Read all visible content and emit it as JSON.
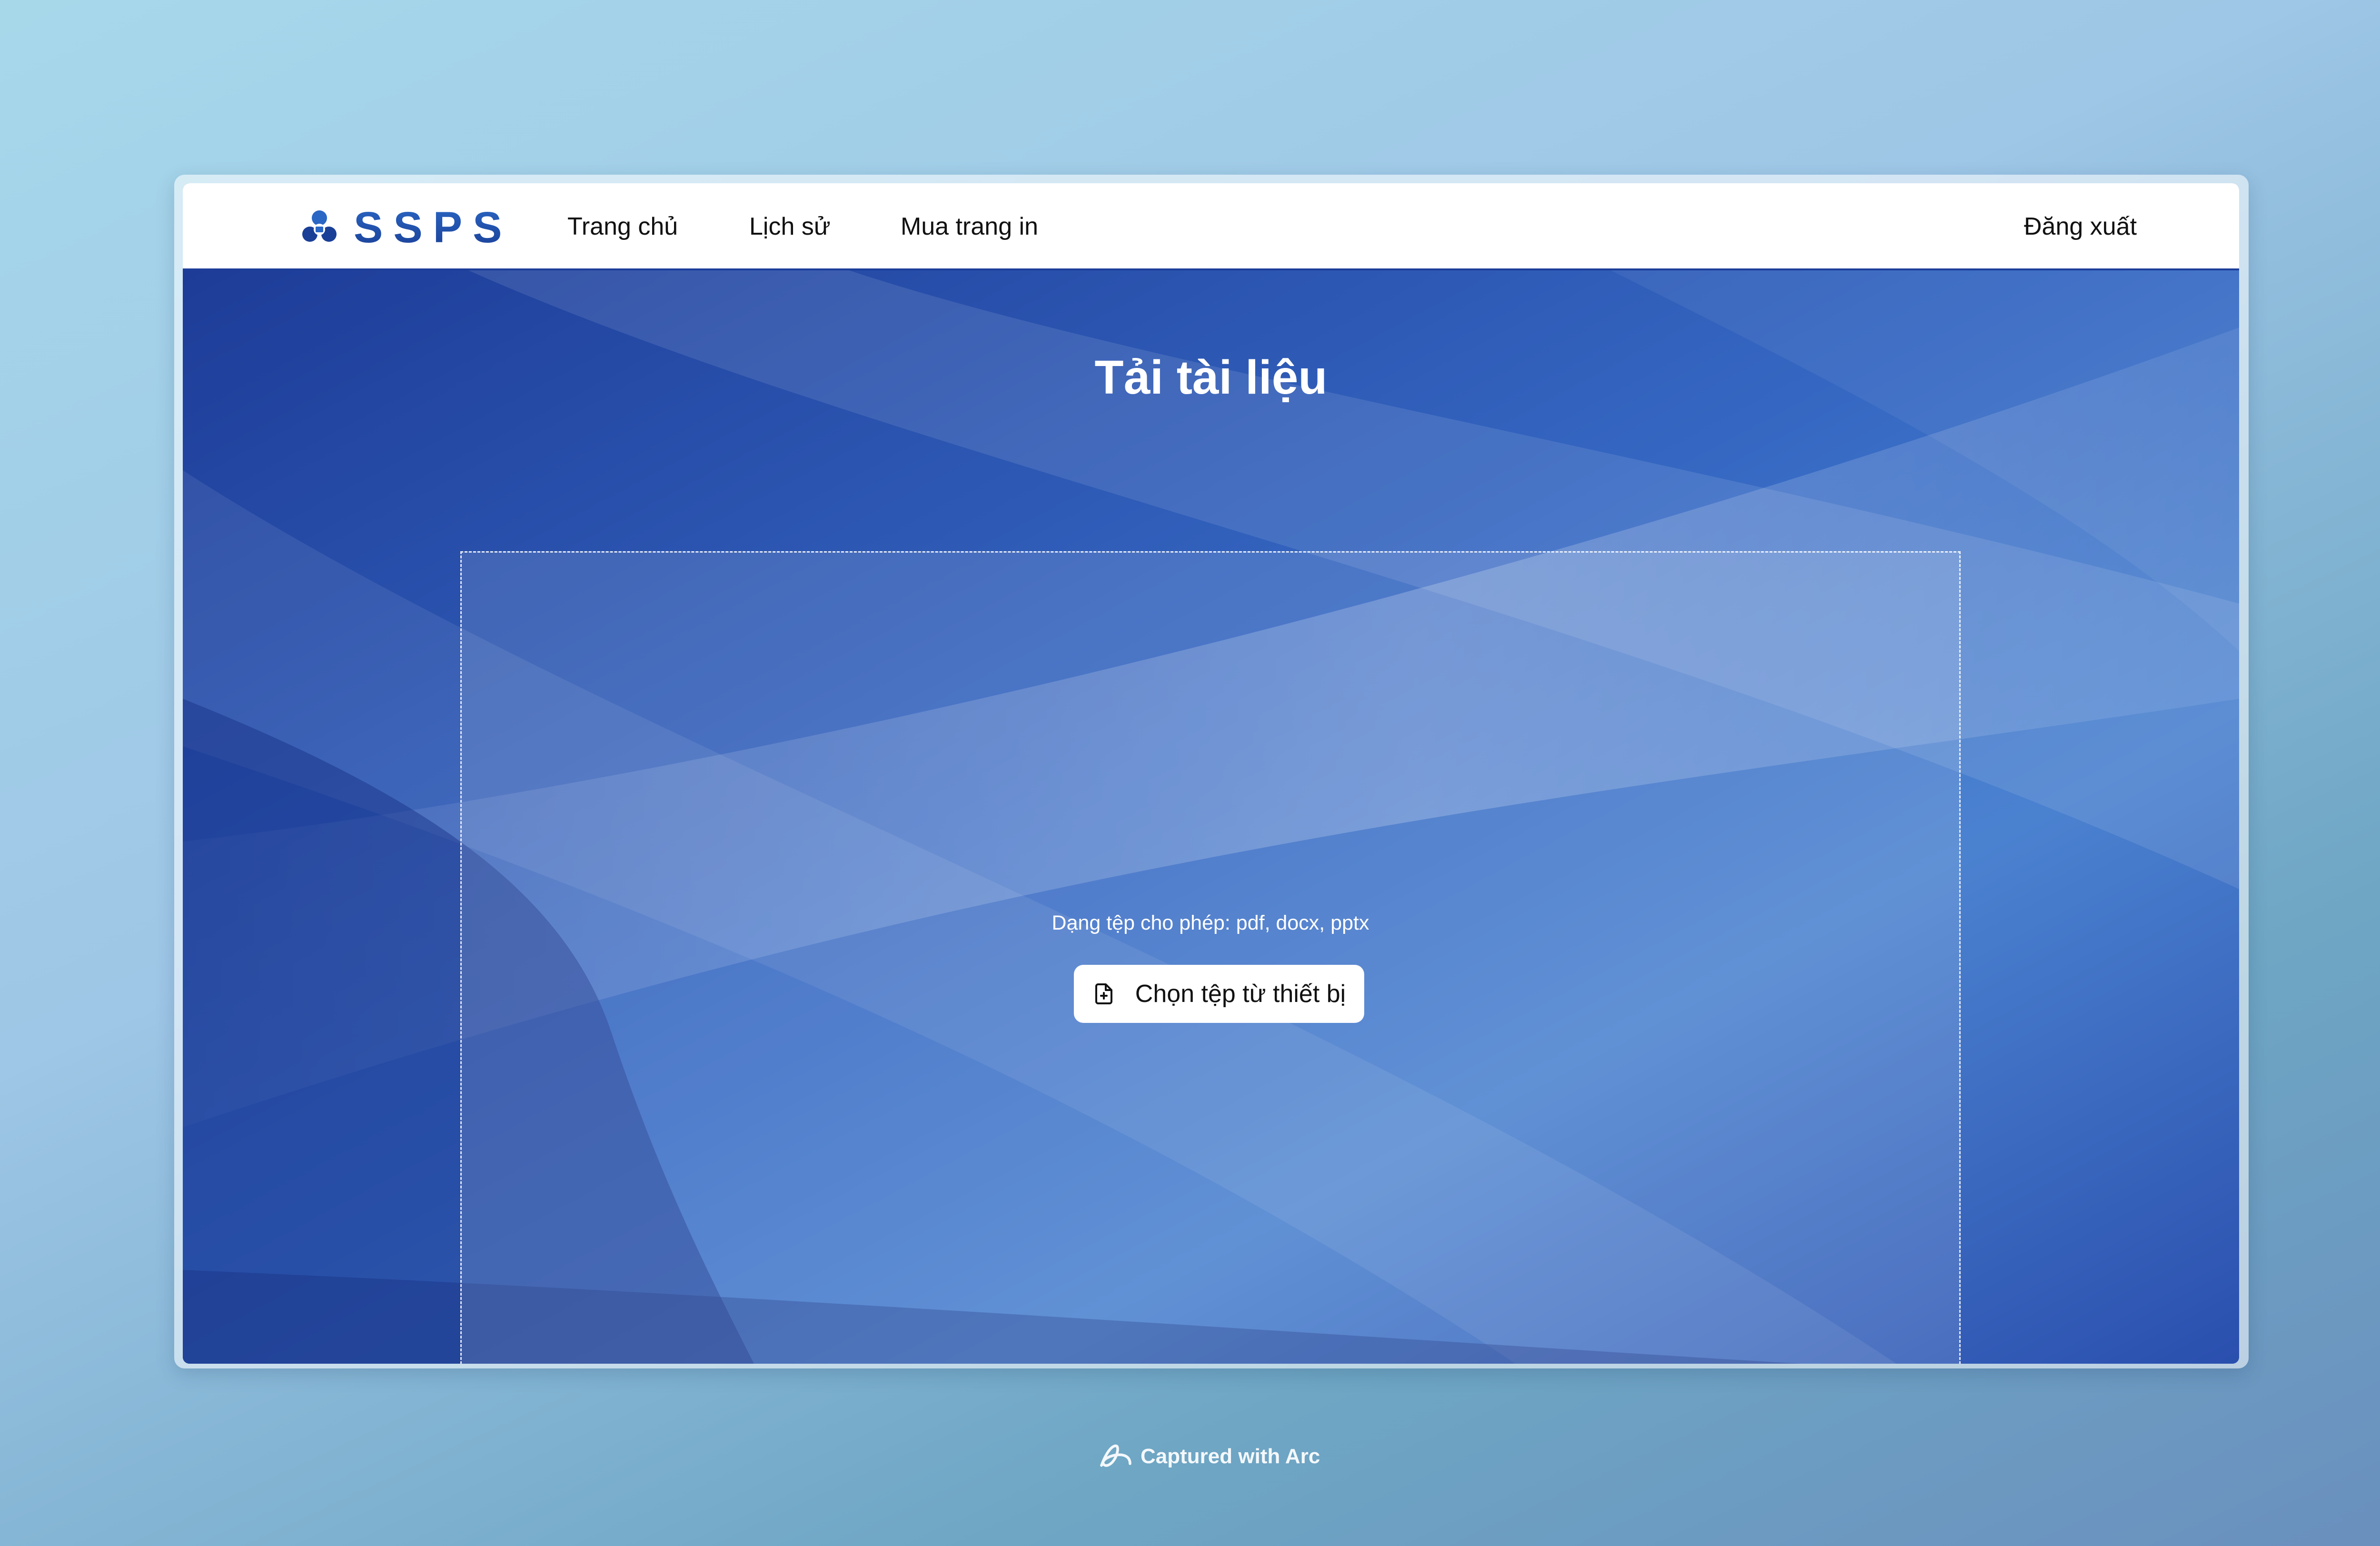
{
  "navbar": {
    "logo_text": "SSPS",
    "items": [
      {
        "label": "Trang chủ"
      },
      {
        "label": "Lịch sử"
      },
      {
        "label": "Mua trang in"
      }
    ],
    "logout_label": "Đăng xuất"
  },
  "main": {
    "title": "Tải tài liệu",
    "dropzone": {
      "allowed_types_text": "Dạng tệp cho phép: pdf, docx, pptx",
      "choose_button_label": "Chọn tệp từ thiết bị",
      "button_icon": "file-plus-icon"
    }
  },
  "caption": {
    "text": "Captured with Arc",
    "icon": "arc-icon"
  },
  "colors": {
    "brand": "#1f4fa8",
    "hero_background": "#2450ad",
    "navbar_background": "#ffffff"
  }
}
